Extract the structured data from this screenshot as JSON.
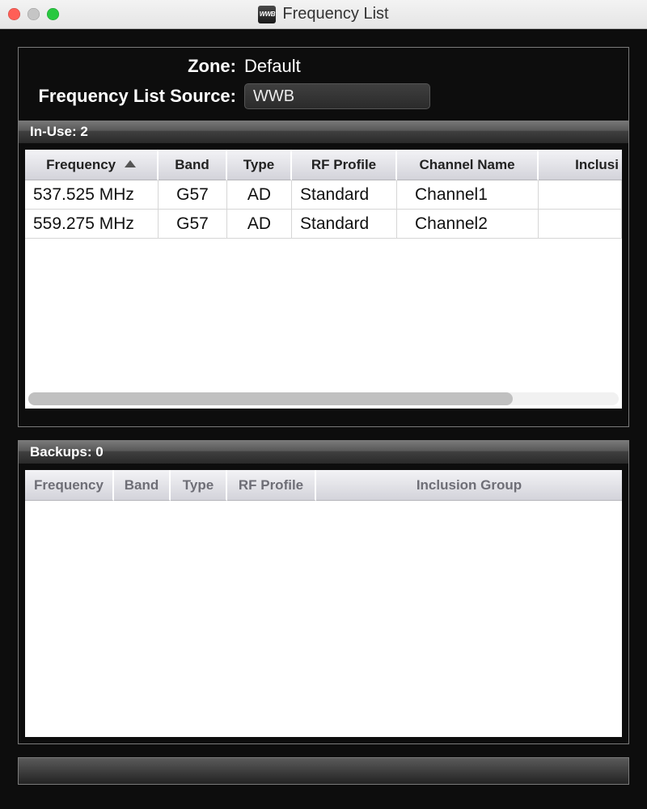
{
  "window": {
    "title": "Frequency List",
    "app_badge": "WWB"
  },
  "header": {
    "zone_label": "Zone:",
    "zone_value": "Default",
    "source_label": "Frequency List Source:",
    "source_value": "WWB"
  },
  "inuse": {
    "heading": "In-Use: 2",
    "columns": {
      "frequency": "Frequency",
      "band": "Band",
      "type": "Type",
      "rf_profile": "RF Profile",
      "channel_name": "Channel Name",
      "inclusion": "Inclusi"
    },
    "rows": [
      {
        "frequency": "537.525 MHz",
        "band": "G57",
        "type": "AD",
        "rf_profile": "Standard",
        "channel_name": "Channel1"
      },
      {
        "frequency": "559.275 MHz",
        "band": "G57",
        "type": "AD",
        "rf_profile": "Standard",
        "channel_name": "Channel2"
      }
    ]
  },
  "backups": {
    "heading": "Backups: 0",
    "columns": {
      "frequency": "Frequency",
      "band": "Band",
      "type": "Type",
      "rf_profile": "RF Profile",
      "inclusion_group": "Inclusion Group"
    }
  }
}
